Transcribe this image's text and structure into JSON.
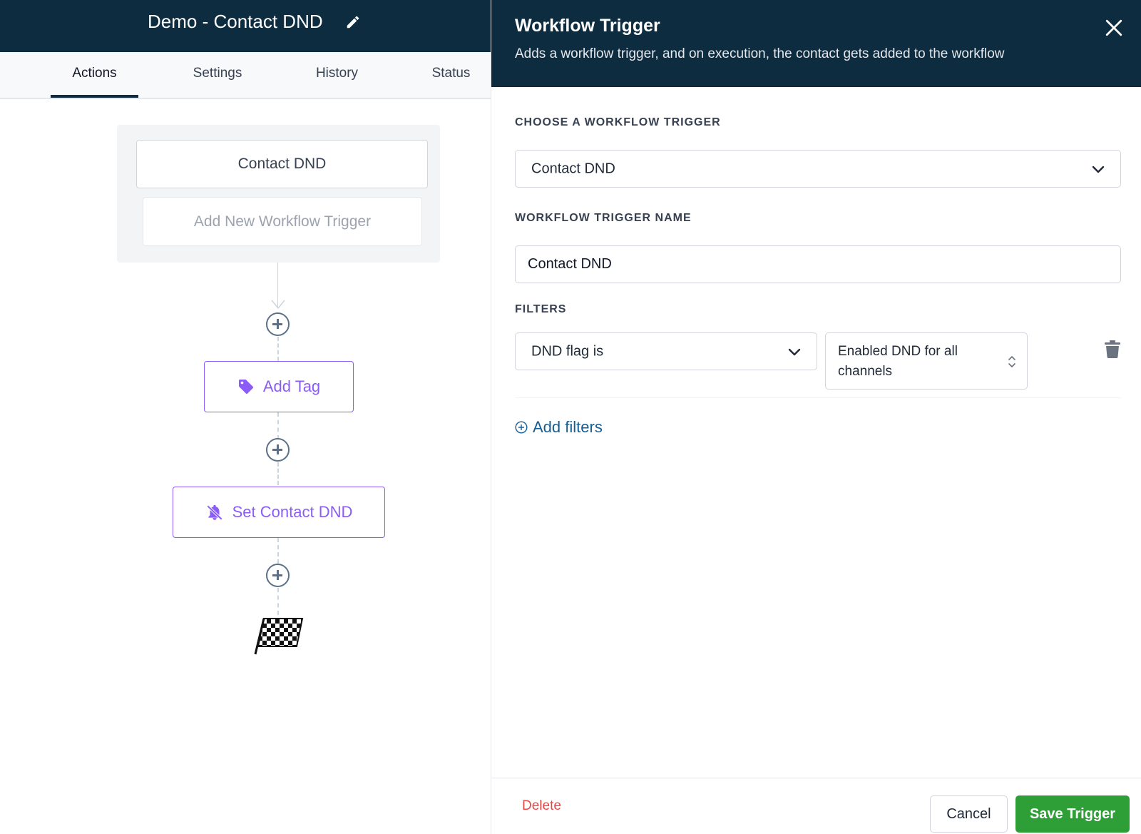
{
  "workflow": {
    "title": "Demo - Contact DND"
  },
  "tabs": [
    {
      "label": "Actions",
      "active": true
    },
    {
      "label": "Settings",
      "active": false
    },
    {
      "label": "History",
      "active": false
    },
    {
      "label": "Status",
      "active": false
    }
  ],
  "canvas": {
    "trigger_label": "Contact DND",
    "add_trigger_label": "Add New Workflow Trigger",
    "actions": [
      {
        "label": "Add Tag",
        "icon": "tag-icon"
      },
      {
        "label": "Set Contact DND",
        "icon": "bell-off-icon"
      }
    ],
    "end_icon": "finish-flag-icon"
  },
  "panel": {
    "title": "Workflow Trigger",
    "subtitle": "Adds a workflow trigger, and on execution, the contact gets added to the workflow",
    "choose_label": "CHOOSE A WORKFLOW TRIGGER",
    "trigger_selected": "Contact DND",
    "name_label": "WORKFLOW TRIGGER NAME",
    "name_value": "Contact DND",
    "filters_label": "FILTERS",
    "filter": {
      "field": "DND flag is",
      "value": "Enabled DND for all channels"
    },
    "add_filters_label": "Add filters",
    "delete_label": "Delete",
    "cancel_label": "Cancel",
    "save_label": "Save Trigger"
  },
  "colors": {
    "header_bg": "#0e2c40",
    "action_accent": "#8b5cf6",
    "save_green": "#2e9e37",
    "delete_red": "#ef4444",
    "link_blue": "#155e94"
  }
}
